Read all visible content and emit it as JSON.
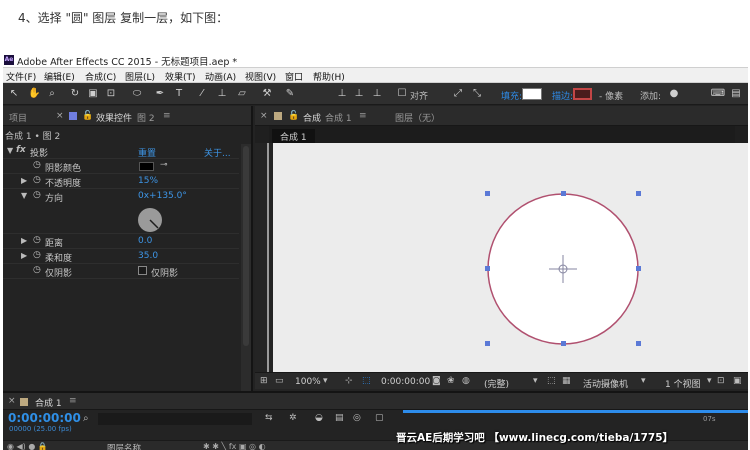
{
  "caption": "4、选择 \"圆\" 图层  复制一层，如下图：",
  "window": {
    "title": "Adobe After Effects CC 2015 - 无标题项目.aep *",
    "logo": "Ae"
  },
  "menu": [
    "文件(F)",
    "编辑(E)",
    "合成(C)",
    "图层(L)",
    "效果(T)",
    "动画(A)",
    "视图(V)",
    "窗口",
    "帮助(H)"
  ],
  "toolbar": {
    "snap_label": "对齐",
    "fill_label": "填充:",
    "stroke_label": "描边:",
    "pixel_label": "- 像素",
    "add_label": "添加:",
    "colors": {
      "fill": "#ffffff",
      "stroke": "#c34646"
    }
  },
  "left_panel": {
    "tabs": {
      "project": "项目",
      "effects": "效果控件",
      "effects_layer": "图 2"
    },
    "breadcrumb": "合成 1 • 图 2",
    "effect": {
      "name": "投影",
      "reset": "重置",
      "about": "关于..."
    },
    "properties": [
      {
        "label": "阴影颜色",
        "value": ""
      },
      {
        "label": "不透明度",
        "value": "15%"
      },
      {
        "label": "方向",
        "value": "0x+135.0°"
      },
      {
        "label": "距离",
        "value": "0.0"
      },
      {
        "label": "柔和度",
        "value": "35.0"
      },
      {
        "label": "仅阴影",
        "value": "仅阴影"
      }
    ]
  },
  "viewer": {
    "tabs": {
      "comp": "合成",
      "comp_name": "合成 1",
      "layer": "图层（无）"
    },
    "comp_chip": "合成 1",
    "footer": {
      "zoom": "100%",
      "timecode": "0:00:00:00",
      "quality": "(完整)",
      "camera": "活动摄像机",
      "views": "1 个视图"
    }
  },
  "timeline": {
    "tab": "合成 1",
    "timecode": "0:00:00:00",
    "fps": "00000 (25.00 fps)",
    "layer_name_header": "图层名称",
    "ruler_label": "07s"
  },
  "watermark": "晋云AE后期学习吧 【www.linecg.com/tieba/1775】",
  "accent": "#2d8ceb"
}
